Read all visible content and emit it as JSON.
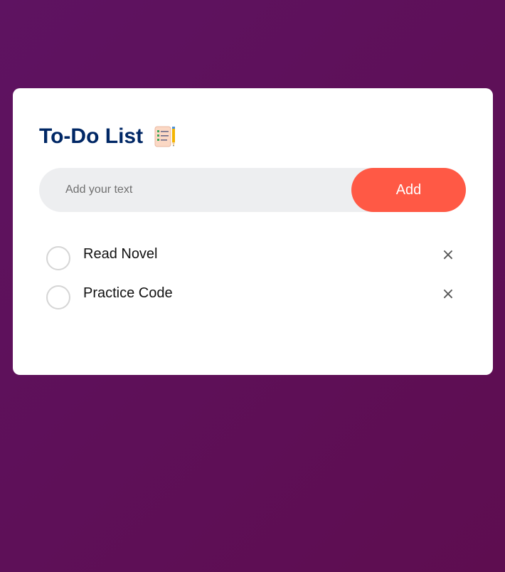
{
  "app": {
    "title": "To-Do List"
  },
  "icons": {
    "title_icon": "checklist-notepad-with-pencil-icon",
    "task_check": "empty-circle-checkbox-icon",
    "task_delete": "close-x-icon"
  },
  "input": {
    "value": "",
    "placeholder": "Add your text"
  },
  "add_button": {
    "label": "Add"
  },
  "tasks": [
    {
      "text": "Read Novel",
      "checked": false,
      "delete_symbol": "×"
    },
    {
      "text": "Practice Code",
      "checked": false,
      "delete_symbol": "×"
    }
  ],
  "colors": {
    "background_start": "#5e1361",
    "background_end": "#5e0d50",
    "card": "#ffffff",
    "title": "#002765",
    "input_bg": "#edeef0",
    "accent": "#ff5945",
    "checkbox_border": "#d5d5d5",
    "delete_icon": "#555555"
  }
}
